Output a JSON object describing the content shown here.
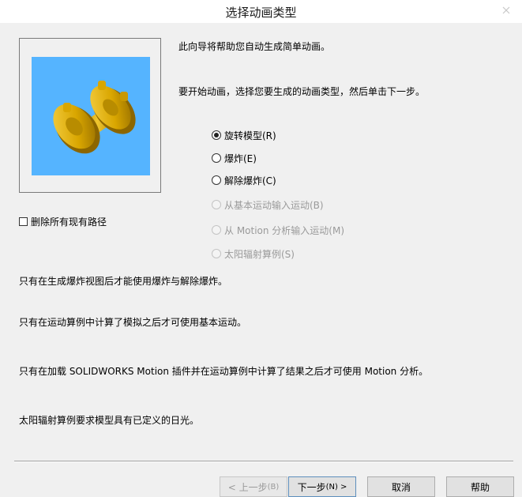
{
  "window": {
    "title": "选择动画类型",
    "close_icon": "close-icon"
  },
  "intro": {
    "line1": "此向导将帮助您自动生成简单动画。",
    "line2": "要开始动画，选择您要生成的动画类型，然后单击下一步。"
  },
  "preview": {
    "background": "#55b4ff",
    "part_color": "#e0b400"
  },
  "checkbox": {
    "label": "删除所有现有路径",
    "checked": false
  },
  "options": [
    {
      "label": "旋转模型(R)",
      "selected": true,
      "enabled": true
    },
    {
      "label": "爆炸(E)",
      "selected": false,
      "enabled": true
    },
    {
      "label": "解除爆炸(C)",
      "selected": false,
      "enabled": true
    },
    {
      "label": "从基本运动输入运动(B)",
      "selected": false,
      "enabled": false
    },
    {
      "label": "从 Motion 分析输入运动(M)",
      "selected": false,
      "enabled": false
    },
    {
      "label": "太阳辐射算例(S)",
      "selected": false,
      "enabled": false
    }
  ],
  "notes": [
    "只有在生成爆炸视图后才能使用爆炸与解除爆炸。",
    "只有在运动算例中计算了模拟之后才可使用基本运动。",
    "只有在加载 SOLIDWORKS Motion 插件并在运动算例中计算了结果之后才可使用 Motion 分析。",
    "太阳辐射算例要求模型具有已定义的日光。"
  ],
  "buttons": {
    "back": {
      "label": "< 上一步",
      "mnemonic": "(B)"
    },
    "next": {
      "label": "下一步",
      "mnemonic": "(N) >"
    },
    "cancel": "取消",
    "help": "帮助"
  }
}
